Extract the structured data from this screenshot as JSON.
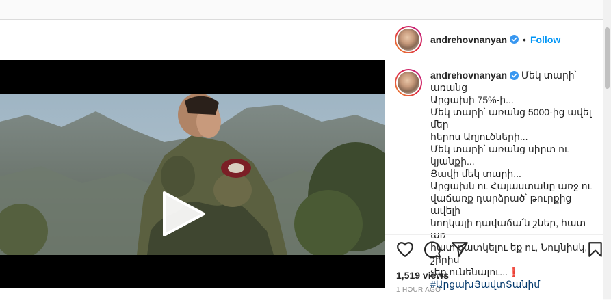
{
  "header": {
    "username": "andrehovnanyan",
    "separator": "•",
    "follow_label": "Follow"
  },
  "caption": {
    "username": "andrehovnanyan",
    "lines": [
      "Մեկ տարի՝ առանց",
      "Արցախի 75%-ի...",
      "Մեկ տարի՝ առանց 5000-ից ավել մեր",
      "հերոս Աղյուծների...",
      "Մեկ տարի՝ առանց սիրտ ու կյանքի...",
      "Ցավի մեկ տարի...",
      "Արցախն ու Հայաստանը առջ ու",
      "վաճառք դարձրած՝ թուրքից ավելի",
      "նողկալի դավաճա՛ն շներ, հատ առ",
      "հատ սատկելու եք ու, Նույնիսկ, շիրիմ",
      "չեք ունենալու...❗"
    ],
    "hashtag": "#ԱրցախՅավտՏանիմ"
  },
  "stats": {
    "views": "1,519 views",
    "timestamp": "1 HOUR AGO"
  },
  "icons": {
    "like": "heart-icon",
    "comment": "comment-icon",
    "share": "share-icon",
    "save": "bookmark-icon",
    "verified": "verified-badge-icon",
    "play": "play-icon"
  },
  "colors": {
    "follow": "#0095f6",
    "verified": "#3897f0",
    "hashtag": "#00376b"
  }
}
